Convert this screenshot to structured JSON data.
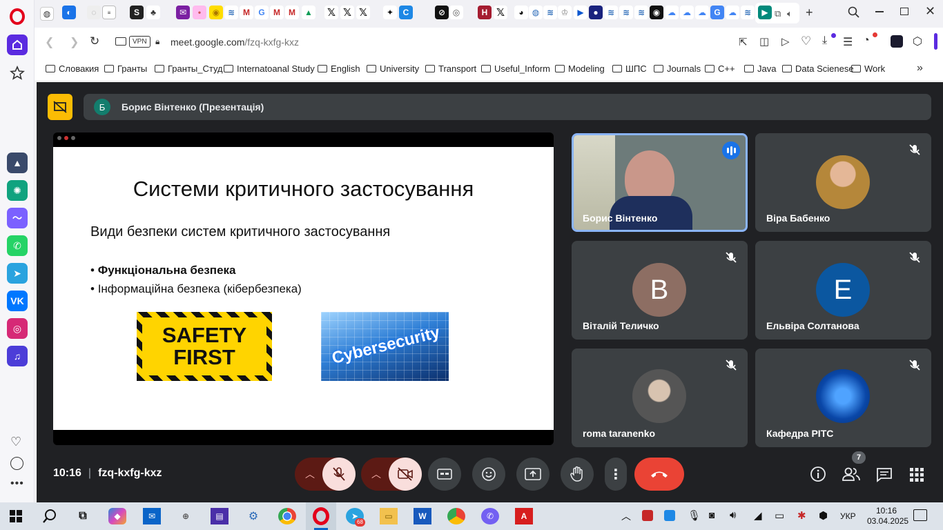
{
  "browser": {
    "vpn": "VPN",
    "url_domain": "meet.google.com",
    "url_path": "/fzq-kxfg-kxz"
  },
  "bookmarks": [
    "Словакия",
    "Гранты",
    "Гранты_Студ",
    "Internatoanal Study",
    "English",
    "University",
    "Transport",
    "Useful_Inform",
    "Modeling",
    "ШПС",
    "Journals",
    "C++",
    "Java",
    "Data Scienese",
    "Work"
  ],
  "meet": {
    "presenter_initial": "Б",
    "presenter_label": "Борис Вінтенко (Презентація)",
    "time": "10:16",
    "code": "fzq-kxfg-kxz",
    "participant_count": "7"
  },
  "slide": {
    "title": "Системи критичного застосування",
    "subtitle": "Види безпеки систем критичного застосування",
    "bullets": [
      "Функціональна безпека",
      "Інформаційна безпека (кібербезпека)"
    ],
    "image1_lines": [
      "SAFETY",
      "FIRST"
    ],
    "image2_text": "Cybersecurity"
  },
  "participants": [
    {
      "name": "Борис Вінтенко",
      "speaking": true
    },
    {
      "name": "Віра Бабенко",
      "muted": true
    },
    {
      "name": "Віталій Теличко",
      "initial": "В",
      "muted": true
    },
    {
      "name": "Ельвіра Солтанова",
      "initial": "E",
      "muted": true
    },
    {
      "name": "roma taranenko",
      "muted": true
    },
    {
      "name": "Кафедра РІТС",
      "muted": true
    }
  ],
  "taskbar": {
    "telegram_badge": "68",
    "language": "УКР",
    "time": "10:16",
    "date": "03.04.2025"
  },
  "colors": {
    "meet_background": "#202124",
    "tile_background": "#3c4043",
    "active_speaker_border": "#8ab4f8",
    "leave_button": "#ea4335",
    "muted_control_bg": "#f9dedc",
    "presentation_badge": "#fbbc04"
  }
}
